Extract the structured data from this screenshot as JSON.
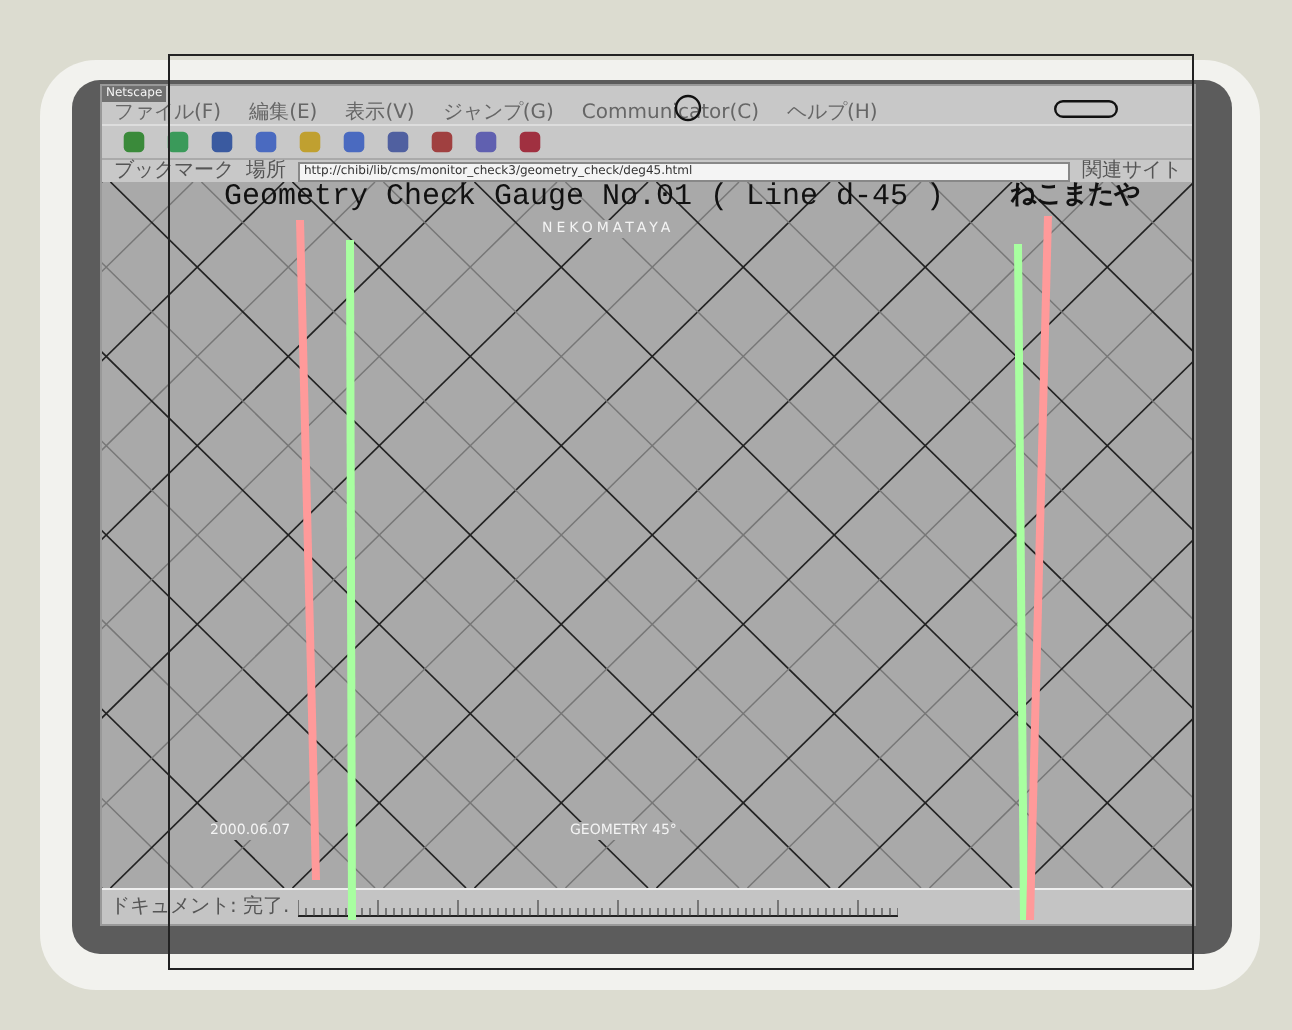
{
  "window": {
    "title": "Netscape"
  },
  "menu": [
    "ファイル(F)",
    "編集(E)",
    "表示(V)",
    "ジャンプ(G)",
    "Communicator(C)",
    "ヘルプ(H)"
  ],
  "location_bar": {
    "bookmarks_label": "ブックマーク",
    "location_label": "場所",
    "url": "http://chibi/lib/cms/monitor_check3/geometry_check/deg45.html",
    "related_label": "関連サイト"
  },
  "content": {
    "brand": "NEKOMATAYA",
    "date": "2000.06.07",
    "caption": "GEOMETRY 45°"
  },
  "status_bar": {
    "text": "ドキュメント: 完了."
  },
  "gauge": {
    "title": "Geometry Check Gauge No.01",
    "subtitle": "( Line d-45 )",
    "brand": "ねこまたや"
  }
}
